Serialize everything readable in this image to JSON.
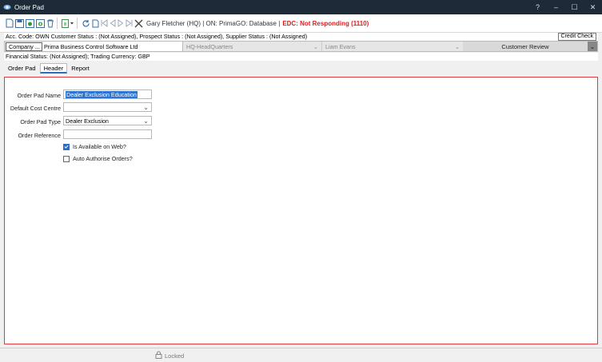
{
  "window": {
    "title": "Order Pad",
    "controls": {
      "help": "?",
      "minimize": "–",
      "maximize": "☐",
      "close": "✕"
    }
  },
  "toolbar": {
    "user_info": "Gary Fletcher (HQ) | ON: PrimaGO: Database |",
    "edc_status": "EDC: Not Responding  (1110)"
  },
  "account": {
    "status_line": "Acc. Code: OWN  Customer Status : (Not Assigned), Prospect Status : (Not Assigned), Supplier Status : (Not Assigned)",
    "credit_check_label": "Credit Check",
    "company_button": "Company ...",
    "company_name": "Prima Business Control Software Ltd",
    "branch": "HQ-HeadQuarters",
    "contact": "Liam Evans",
    "review": "Customer Review",
    "financial_line": "Financial Status: (Not Assigned); Trading Currency: GBP"
  },
  "tabs": [
    {
      "label": "Order Pad"
    },
    {
      "label": "Header"
    },
    {
      "label": "Report"
    }
  ],
  "form": {
    "order_pad_name": {
      "label": "Order Pad Name",
      "value": "Dealer Exclusion Education"
    },
    "default_cost_centre": {
      "label": "Default Cost Centre",
      "value": ""
    },
    "order_pad_type": {
      "label": "Order Pad Type",
      "value": "Dealer Exclusion"
    },
    "order_reference": {
      "label": "Order Reference",
      "value": ""
    },
    "available_on_web": {
      "label": "Is Available on Web?",
      "checked": true
    },
    "auto_authorise": {
      "label": "Auto Authorise Orders?",
      "checked": false
    }
  },
  "footer": {
    "lock_label": "Locked"
  },
  "colors": {
    "accent": "#2b6cc4",
    "error": "#e01e1e",
    "panel_border": "#e23b3b",
    "titlebar": "#1e2a38"
  }
}
